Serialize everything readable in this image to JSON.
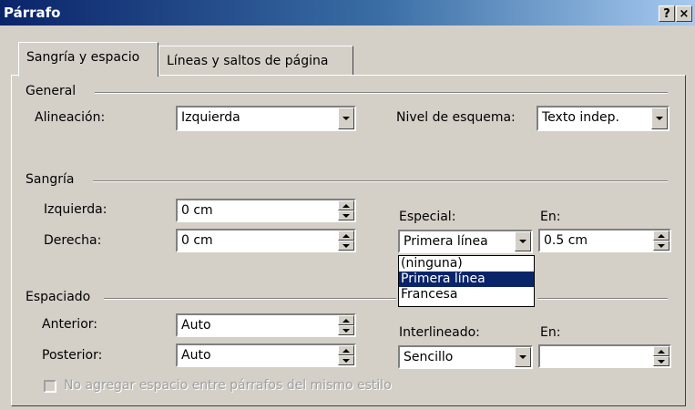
{
  "window": {
    "title": "Párrafo",
    "help_glyph": "?",
    "close_glyph": "×"
  },
  "tabs": [
    {
      "label": "Sangría y espacio"
    },
    {
      "label": "Líneas y saltos de página"
    }
  ],
  "general": {
    "section": "General",
    "alignment_label": "Alineación:",
    "alignment_value": "Izquierda",
    "outline_label": "Nivel de esquema:",
    "outline_value": "Texto indep."
  },
  "indent": {
    "section": "Sangría",
    "left_label": "Izquierda:",
    "left_value": "0 cm",
    "right_label": "Derecha:",
    "right_value": "0 cm",
    "special_label": "Especial:",
    "special_value": "Primera línea",
    "special_options": [
      "(ninguna)",
      "Primera línea",
      "Francesa"
    ],
    "special_selected_index": 1,
    "by_label": "En:",
    "by_value": "0.5 cm"
  },
  "spacing": {
    "section": "Espaciado",
    "before_label": "Anterior:",
    "before_value": "Auto",
    "after_label": "Posterior:",
    "after_value": "Auto",
    "line_label": "Interlineado:",
    "line_value": "Sencillo",
    "at_label": "En:",
    "at_value": "",
    "dont_add_label": "No agregar espacio entre párrafos del mismo estilo",
    "dont_add_checked": false
  },
  "colors": {
    "title_gradient_start": "#0a246a",
    "title_gradient_end": "#a6caf0",
    "dialog_bg": "#d4d0c8",
    "selection": "#0a246a"
  }
}
